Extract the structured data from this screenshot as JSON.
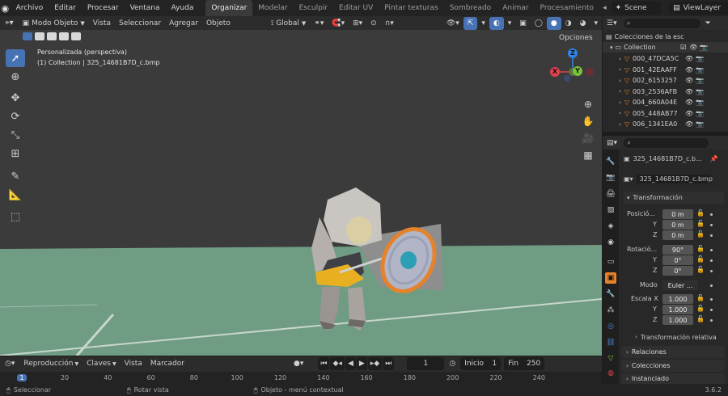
{
  "app": {
    "version": "3.6.2"
  },
  "menu": [
    "Archivo",
    "Editar",
    "Procesar",
    "Ventana",
    "Ayuda"
  ],
  "workspaces": [
    "Organizar",
    "Modelar",
    "Esculpir",
    "Editar UV",
    "Pintar texturas",
    "Sombreado",
    "Animar",
    "Procesamiento"
  ],
  "scene": {
    "name": "Scene",
    "viewlayer": "ViewLayer"
  },
  "viewport_header": {
    "mode": "Modo Objeto",
    "menus": [
      "Vista",
      "Seleccionar",
      "Agregar",
      "Objeto"
    ],
    "orientation": "Global",
    "options": "Opciones"
  },
  "viewport_overlay": {
    "view_name": "Personalizada (perspectiva)",
    "collection_line": "(1) Collection | 325_14681B7D_c.bmp"
  },
  "gizmo": {
    "x": "X",
    "y": "Y",
    "z": "Z"
  },
  "outliner": {
    "root": "Colecciones de la esc",
    "collection": "Collection",
    "items": [
      "000_47DCA5C",
      "001_42EAAFF",
      "002_6153257",
      "003_2536AFB",
      "004_660A04E",
      "005_448AB77",
      "006_1341EA0"
    ]
  },
  "properties": {
    "object_name_header": "325_14681B7D_c.b...",
    "object_name": "325_14681B7D_c.bmp",
    "transform_title": "Transformación",
    "location_label": "Posició...",
    "location": {
      "x": "0 m",
      "y": "0 m",
      "z": "0 m"
    },
    "rotation_label": "Rotació...",
    "rotation": {
      "x": "90°",
      "y": "0°",
      "z": "0°"
    },
    "mode_label": "Modo",
    "mode_value": "Euler ...",
    "scale_label": "Escala X",
    "scale": {
      "x": "1.000",
      "y": "1.000",
      "z": "1.000"
    },
    "axis_y": "Y",
    "axis_z": "Z",
    "delta_transform": "Transformación relativa",
    "relations": "Relaciones",
    "collections": "Colecciones",
    "instancing": "Instanciado"
  },
  "timeline": {
    "menus": [
      "Reproducción",
      "Claves",
      "Vista",
      "Marcador"
    ],
    "current_frame": "1",
    "start_label": "Inicio",
    "start": "1",
    "end_label": "Fin",
    "end": "250",
    "ruler": [
      "1",
      "20",
      "40",
      "60",
      "80",
      "100",
      "120",
      "140",
      "160",
      "180",
      "200",
      "220",
      "240"
    ]
  },
  "status": {
    "select": "Seleccionar",
    "rotate": "Rotar vista",
    "context": "Objeto - menú contextual"
  },
  "colors": {
    "accent": "#4772b3",
    "floor": "#6f9c83",
    "object_orange": "#e5832c",
    "gizmo_x": "#e0404f",
    "gizmo_y": "#79c23b",
    "gizmo_z": "#2f84e6"
  }
}
